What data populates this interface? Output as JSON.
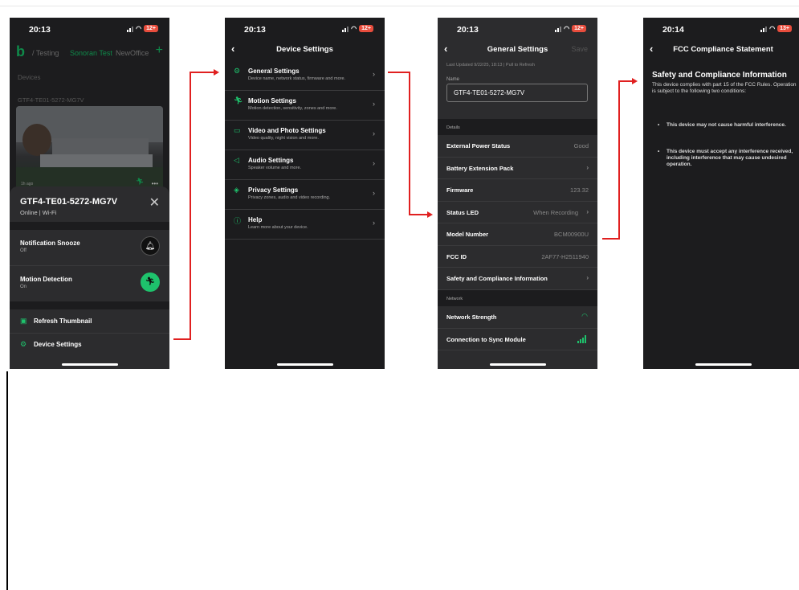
{
  "phone1": {
    "time": "20:13",
    "battery": "12+",
    "tabs": [
      "/ Testing",
      "Sonoran Test",
      "NewOffice"
    ],
    "devices_label": "Devices",
    "camera_name": "GTF4-TE01-5272-MG7V",
    "thumb_age": "1h ago",
    "sheet": {
      "title": "GTF4-TE01-5272-MG7V",
      "subtitle": "Online | Wi-Fi",
      "rows": [
        {
          "label": "Notification Snooze",
          "sub": "Off"
        },
        {
          "label": "Motion Detection",
          "sub": "On"
        }
      ],
      "actions": [
        {
          "label": "Refresh Thumbnail"
        },
        {
          "label": "Device Settings"
        }
      ]
    }
  },
  "phone2": {
    "time": "20:13",
    "battery": "12+",
    "title": "Device Settings",
    "items": [
      {
        "label": "General Settings",
        "sub": "Device name, network status, firmware and more."
      },
      {
        "label": "Motion Settings",
        "sub": "Motion detection, sensitivity, zones and more."
      },
      {
        "label": "Video and Photo Settings",
        "sub": "Video quality, night vision and more."
      },
      {
        "label": "Audio Settings",
        "sub": "Speaker volume and more."
      },
      {
        "label": "Privacy Settings",
        "sub": "Privacy zones, audio and video recording."
      },
      {
        "label": "Help",
        "sub": "Learn more about your device."
      }
    ]
  },
  "phone3": {
    "time": "20:13",
    "battery": "12+",
    "title": "General Settings",
    "save": "Save",
    "updated": "Last Updated 9/22/25, 18:13 | Pull to Refresh",
    "name_label": "Name",
    "name_value": "GTF4-TE01-5272-MG7V",
    "details_label": "Details",
    "rows": [
      {
        "label": "External Power Status",
        "value": "Good"
      },
      {
        "label": "Battery Extension Pack",
        "value": ""
      },
      {
        "label": "Firmware",
        "value": "123.32"
      },
      {
        "label": "Status LED",
        "value": "When Recording"
      },
      {
        "label": "Model Number",
        "value": "BCM00900U"
      },
      {
        "label": "FCC ID",
        "value": "2AF77-H2511940"
      },
      {
        "label": "Safety and Compliance Information",
        "value": ""
      }
    ],
    "network_label": "Network",
    "network_rows": [
      {
        "label": "Network Strength"
      },
      {
        "label": "Connection to Sync Module"
      }
    ]
  },
  "phone4": {
    "time": "20:14",
    "battery": "13+",
    "title": "FCC Compliance Statement",
    "heading": "Safety and Compliance Information",
    "paragraph": "This device complies with part 15 of the FCC Rules. Operation is subject to the following two conditions:",
    "bullets": [
      "This device may not cause harmful interference.",
      "This device must accept any interference received, including interference that may cause undesired operation."
    ]
  },
  "colors": {
    "accent": "#1ec26c",
    "arrow": "#e02020",
    "background": "#1c1c1e",
    "row": "#2c2c2e"
  }
}
